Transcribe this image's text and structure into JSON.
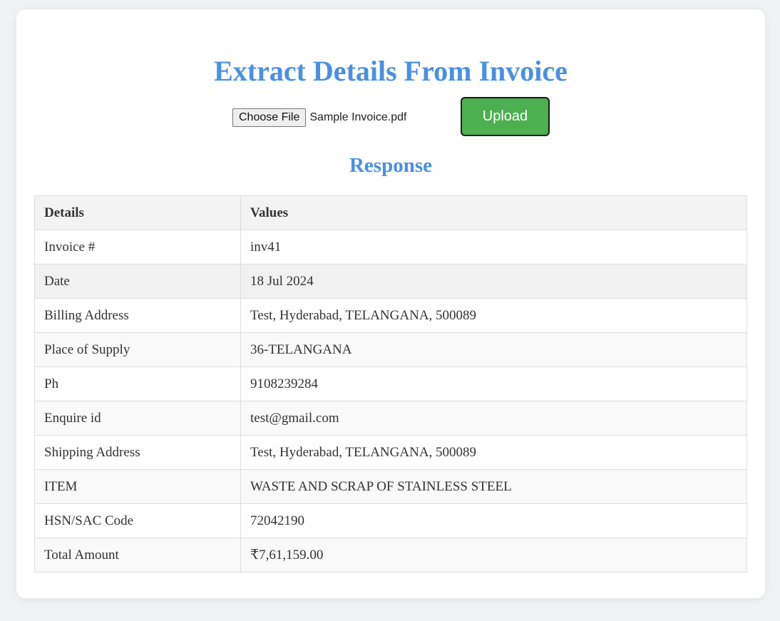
{
  "header": {
    "title": "Extract Details From Invoice"
  },
  "upload": {
    "choose_label": "Choose File",
    "file_name": "Sample Invoice.pdf",
    "upload_label": "Upload"
  },
  "response": {
    "title": "Response",
    "columns": [
      "Details",
      "Values"
    ],
    "rows": [
      {
        "detail": "Invoice #",
        "value": "inv41"
      },
      {
        "detail": "Date",
        "value": "18 Jul 2024"
      },
      {
        "detail": "Billing Address",
        "value": "Test, Hyderabad, TELANGANA, 500089"
      },
      {
        "detail": "Place of Supply",
        "value": "36-TELANGANA"
      },
      {
        "detail": "Ph",
        "value": "9108239284"
      },
      {
        "detail": "Enquire id",
        "value": "test@gmail.com"
      },
      {
        "detail": "Shipping Address",
        "value": "Test, Hyderabad, TELANGANA, 500089"
      },
      {
        "detail": "ITEM",
        "value": "WASTE AND SCRAP OF STAINLESS STEEL"
      },
      {
        "detail": "HSN/SAC Code",
        "value": "72042190"
      },
      {
        "detail": "Total Amount",
        "value": "₹7,61,159.00"
      }
    ]
  },
  "colors": {
    "accent": "#4a90e2",
    "upload_button": "#4caf50",
    "background": "#f0f2f5"
  }
}
